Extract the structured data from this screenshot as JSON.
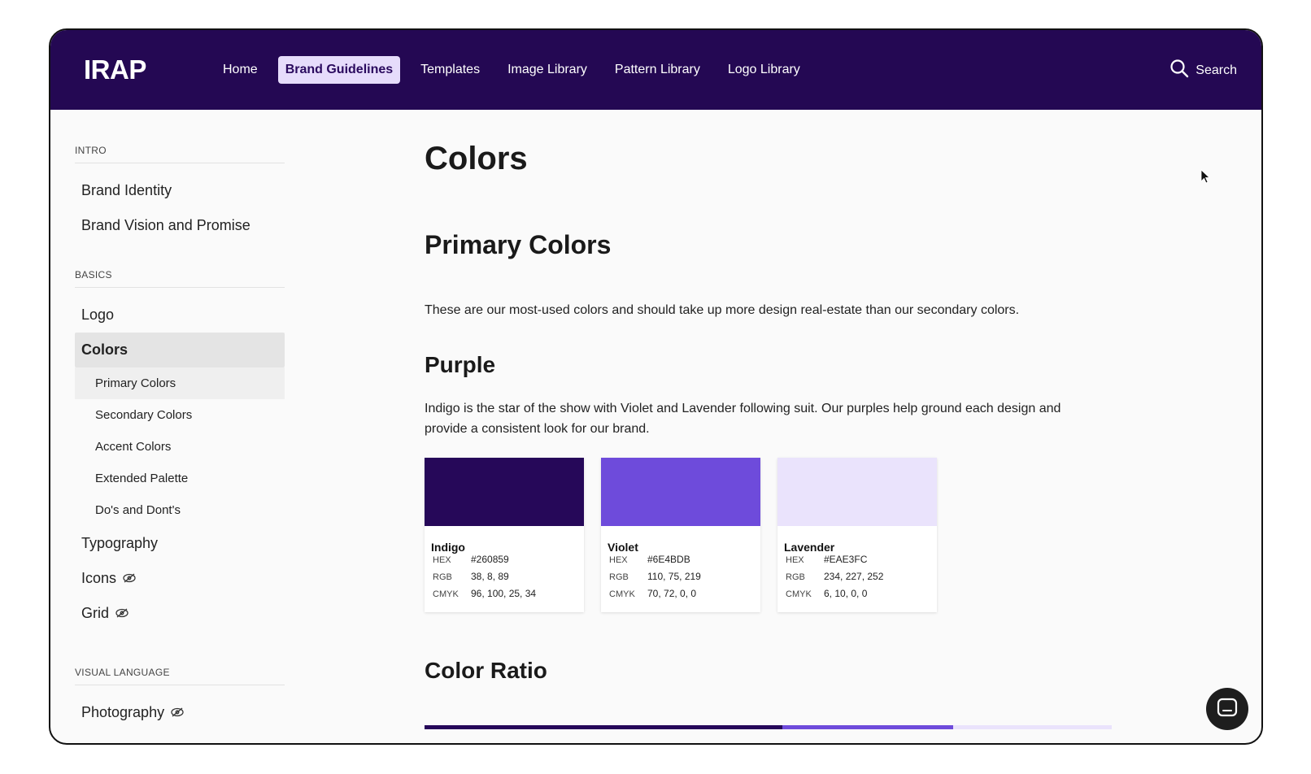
{
  "header": {
    "logo": "IRAP",
    "nav": [
      "Home",
      "Brand Guidelines",
      "Templates",
      "Image Library",
      "Pattern Library",
      "Logo Library"
    ],
    "active_nav": "Brand Guidelines",
    "search_label": "Search"
  },
  "sidebar": {
    "intro_label": "INTRO",
    "intro_items": [
      "Brand Identity",
      "Brand Vision and Promise"
    ],
    "basics_label": "BASICS",
    "logo": "Logo",
    "colors": "Colors",
    "color_subs": [
      "Primary Colors",
      "Secondary Colors",
      "Accent Colors",
      "Extended Palette",
      "Do's and Dont's"
    ],
    "typography": "Typography",
    "icons": "Icons",
    "grid": "Grid",
    "visual_label": "VISUAL LANGUAGE",
    "photography": "Photography"
  },
  "main": {
    "title": "Colors",
    "primary_heading": "Primary Colors",
    "primary_desc": "These are our most-used colors and should take up more design real-estate than our secondary colors.",
    "purple_heading": "Purple",
    "purple_desc_1": "Indigo is the star of the show with Violet and Lavender following suit. Our purples help ground each design and",
    "purple_desc_2": "provide a consistent look for our brand.",
    "labels": {
      "hex": "HEX",
      "rgb": "RGB",
      "cmyk": "CMYK"
    },
    "swatches": [
      {
        "name": "Indigo",
        "hex": "#260859",
        "rgb": "38, 8, 89",
        "cmyk": "96, 100, 25, 34",
        "color": "#260859"
      },
      {
        "name": "Violet",
        "hex": "#6E4BDB",
        "rgb": "110, 75, 219",
        "cmyk": "70, 72, 0, 0",
        "color": "#6E4BDB"
      },
      {
        "name": "Lavender",
        "hex": "#EAE3FC",
        "rgb": "234, 227, 252",
        "cmyk": "6, 10, 0, 0",
        "color": "#EAE3FC"
      }
    ],
    "ratio_heading": "Color Ratio"
  },
  "colors": {
    "nav_bg": "#240853",
    "active_nav_bg": "#E6DCFB"
  },
  "icons": {
    "search": "search-icon",
    "hidden": "eye-off-icon",
    "chat": "chat-icon",
    "cursor": "cursor-icon"
  }
}
